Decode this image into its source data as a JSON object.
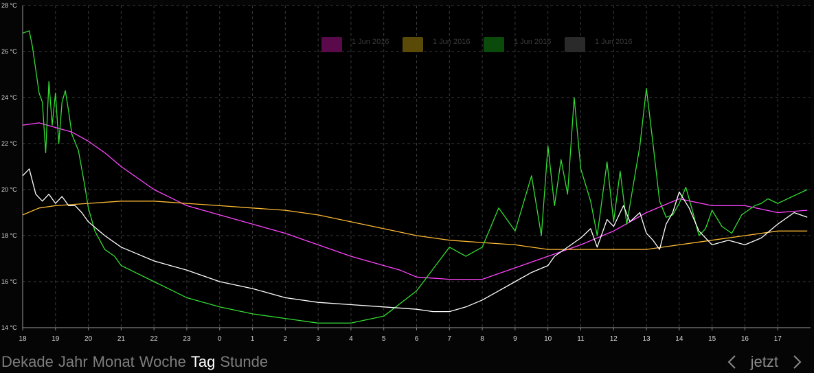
{
  "chart_data": {
    "type": "line",
    "x_ticks": [
      "18",
      "19",
      "20",
      "21",
      "22",
      "23",
      "0",
      "1",
      "2",
      "3",
      "4",
      "5",
      "6",
      "7",
      "8",
      "9",
      "10",
      "11",
      "12",
      "13",
      "14",
      "15",
      "16",
      "17"
    ],
    "y_ticks": [
      "14 °C",
      "16 °C",
      "18 °C",
      "20 °C",
      "22 °C",
      "24 °C",
      "26 °C",
      "28 °C"
    ],
    "x_range": [
      0,
      24
    ],
    "ylim": [
      14,
      28
    ],
    "grid": true,
    "legend": [
      {
        "label": "1 Jun 2016",
        "color": "#5a0a4a"
      },
      {
        "label": "1 Jun 2016",
        "color": "#5a4a08"
      },
      {
        "label": "1 Jun 2016",
        "color": "#0a4a0a"
      },
      {
        "label": "1 Jun 2016",
        "color": "#2a2a2a"
      }
    ],
    "series": [
      {
        "color": "#ff44ff",
        "x": [
          0,
          0.5,
          1,
          1.5,
          2,
          2.5,
          3,
          4,
          5,
          6,
          7,
          8,
          9,
          10,
          11,
          11.5,
          12,
          13,
          14,
          15,
          16,
          17,
          18,
          19,
          20,
          21,
          22,
          23,
          23.9
        ],
        "y": [
          22.8,
          22.9,
          22.7,
          22.5,
          22.1,
          21.6,
          21.0,
          20.0,
          19.3,
          18.9,
          18.5,
          18.1,
          17.6,
          17.1,
          16.7,
          16.5,
          16.2,
          16.1,
          16.1,
          16.6,
          17.1,
          17.6,
          18.2,
          19.0,
          19.6,
          19.3,
          19.3,
          19.0,
          19.1
        ]
      },
      {
        "color": "#ffbb33",
        "x": [
          0,
          0.5,
          1,
          2,
          3,
          4,
          5,
          6,
          7,
          8,
          9,
          10,
          11,
          12,
          13,
          14,
          15,
          16,
          17,
          18,
          19,
          20,
          21,
          22,
          23,
          23.9
        ],
        "y": [
          18.9,
          19.2,
          19.3,
          19.4,
          19.5,
          19.5,
          19.4,
          19.3,
          19.2,
          19.1,
          18.9,
          18.6,
          18.3,
          18.0,
          17.8,
          17.7,
          17.6,
          17.4,
          17.4,
          17.4,
          17.4,
          17.6,
          17.8,
          18.0,
          18.2,
          18.2
        ]
      },
      {
        "color": "#33dd33",
        "x": [
          0,
          0.2,
          0.3,
          0.5,
          0.6,
          0.7,
          0.8,
          0.9,
          1.0,
          1.1,
          1.2,
          1.3,
          1.4,
          1.5,
          1.7,
          1.9,
          2.0,
          2.2,
          2.5,
          2.8,
          3.0,
          4.0,
          5.0,
          6.0,
          7.0,
          8.0,
          9.0,
          10.0,
          11.0,
          12.0,
          13.0,
          13.5,
          14.0,
          14.5,
          15.0,
          15.5,
          15.8,
          16.0,
          16.2,
          16.4,
          16.6,
          16.8,
          17.0,
          17.3,
          17.5,
          17.8,
          18.0,
          18.2,
          18.4,
          18.6,
          18.8,
          19.0,
          19.2,
          19.4,
          19.6,
          19.8,
          20.0,
          20.2,
          20.4,
          20.6,
          20.8,
          21.0,
          21.3,
          21.6,
          21.9,
          22.0,
          22.3,
          22.5,
          22.7,
          23.0,
          23.3,
          23.6,
          23.9
        ],
        "y": [
          26.8,
          26.9,
          26.2,
          24.2,
          23.8,
          21.6,
          24.7,
          22.8,
          24.2,
          22.0,
          23.8,
          24.3,
          23.4,
          22.4,
          21.7,
          20.1,
          19.2,
          18.2,
          17.4,
          17.1,
          16.7,
          16.0,
          15.3,
          14.9,
          14.6,
          14.4,
          14.2,
          14.2,
          14.5,
          15.6,
          17.5,
          17.1,
          17.5,
          19.2,
          18.2,
          20.6,
          18.0,
          21.9,
          19.3,
          21.3,
          19.8,
          24.0,
          20.9,
          19.5,
          18.0,
          21.2,
          18.6,
          20.8,
          18.5,
          20.2,
          21.9,
          24.4,
          22.0,
          19.5,
          18.8,
          18.9,
          19.4,
          20.1,
          19.1,
          18.0,
          18.3,
          19.1,
          18.4,
          18.1,
          18.9,
          19.0,
          19.3,
          19.4,
          19.6,
          19.4,
          19.6,
          19.8,
          20.0
        ]
      },
      {
        "color": "#ffffff",
        "x": [
          0,
          0.2,
          0.4,
          0.6,
          0.8,
          1.0,
          1.2,
          1.4,
          1.6,
          1.8,
          2.0,
          2.5,
          3.0,
          3.5,
          4.0,
          4.5,
          5.0,
          6.0,
          7.0,
          8.0,
          9.0,
          10.0,
          11.0,
          12.0,
          12.5,
          13.0,
          13.5,
          14.0,
          14.5,
          15.0,
          15.5,
          16.0,
          16.2,
          16.5,
          17.0,
          17.3,
          17.5,
          17.8,
          18.0,
          18.3,
          18.5,
          18.8,
          19.0,
          19.2,
          19.4,
          19.6,
          19.8,
          20.0,
          20.3,
          20.6,
          21.0,
          21.5,
          22.0,
          22.5,
          23.0,
          23.5,
          23.9
        ],
        "y": [
          20.6,
          20.9,
          19.8,
          19.5,
          19.8,
          19.4,
          19.7,
          19.3,
          19.3,
          19.0,
          18.6,
          18.0,
          17.5,
          17.2,
          16.9,
          16.7,
          16.5,
          16.0,
          15.7,
          15.3,
          15.1,
          15.0,
          14.9,
          14.8,
          14.7,
          14.7,
          14.9,
          15.2,
          15.6,
          16.0,
          16.4,
          16.7,
          17.1,
          17.4,
          17.9,
          18.3,
          17.5,
          18.7,
          18.4,
          19.3,
          18.6,
          19.0,
          18.1,
          17.8,
          17.4,
          18.5,
          19.0,
          19.9,
          19.2,
          18.2,
          17.6,
          17.8,
          17.6,
          17.9,
          18.5,
          19.0,
          18.8
        ]
      }
    ]
  },
  "nav": {
    "views": [
      "Dekade",
      "Jahr",
      "Monat",
      "Woche",
      "Tag",
      "Stunde"
    ],
    "active_view": "Tag",
    "now_label": "jetzt",
    "prev_icon": "chevron-left-icon",
    "next_icon": "chevron-right-icon"
  }
}
